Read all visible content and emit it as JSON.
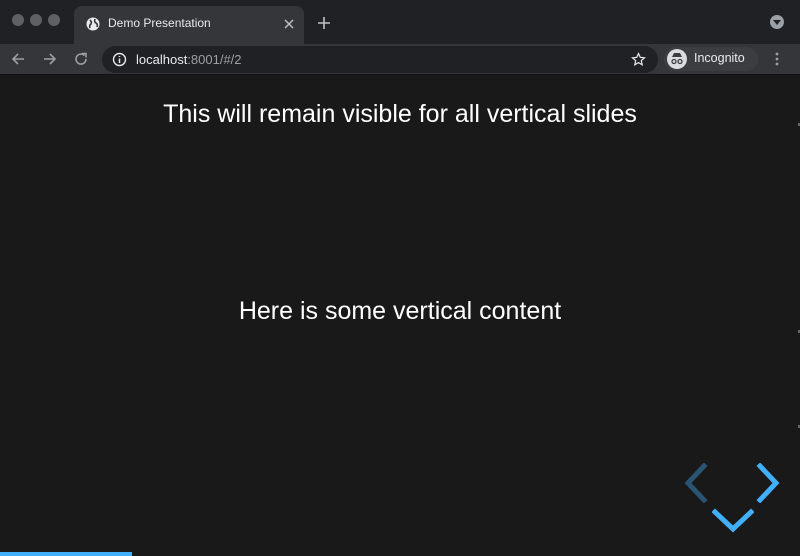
{
  "browser": {
    "tab_title": "Demo Presentation",
    "url_host": "localhost",
    "url_rest": ":8001/#/2",
    "incognito_label": "Incognito",
    "accent": "#42affa"
  },
  "slide": {
    "persistent_heading": "This will remain visible for all vertical slides",
    "content": "Here is some vertical content",
    "progress_fraction": 0.165
  },
  "controls": {
    "left": "chevron-left-icon",
    "right": "chevron-right-icon",
    "down": "chevron-down-icon"
  }
}
